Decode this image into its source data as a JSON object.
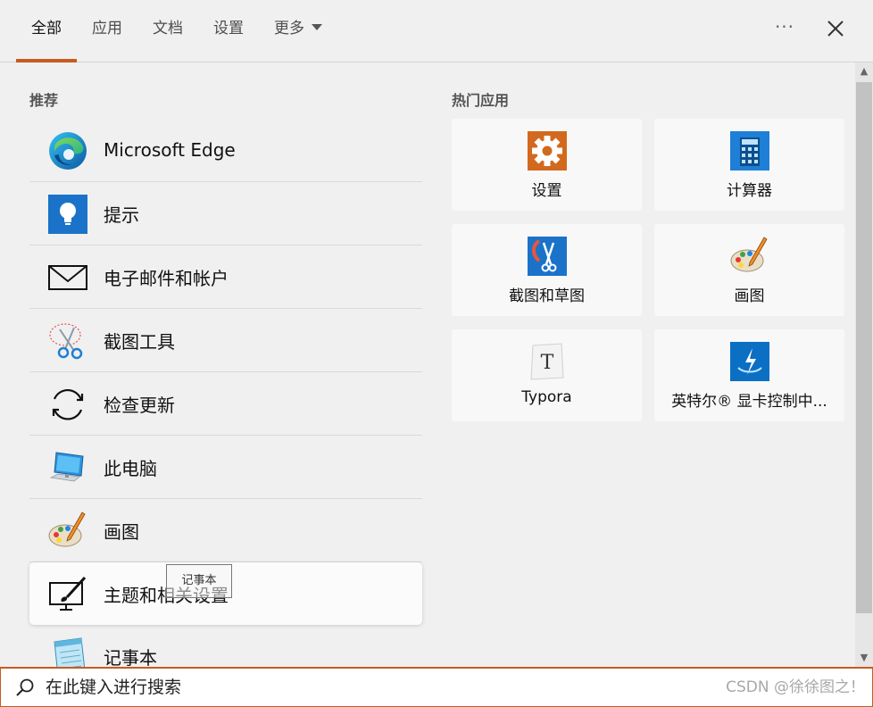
{
  "tabs": [
    {
      "label": "全部",
      "active": true
    },
    {
      "label": "应用",
      "active": false
    },
    {
      "label": "文档",
      "active": false
    },
    {
      "label": "设置",
      "active": false
    },
    {
      "label": "更多",
      "active": false,
      "dropdown": true
    }
  ],
  "header_icons": {
    "more": "more-options-icon",
    "close": "close-icon"
  },
  "recommended": {
    "title": "推荐",
    "items": [
      {
        "label": "Microsoft Edge",
        "icon": "edge-icon"
      },
      {
        "label": "提示",
        "icon": "tips-icon"
      },
      {
        "label": "电子邮件和帐户",
        "icon": "mail-icon"
      },
      {
        "label": "截图工具",
        "icon": "snipping-tool-icon"
      },
      {
        "label": "检查更新",
        "icon": "refresh-icon"
      },
      {
        "label": "此电脑",
        "icon": "computer-icon"
      },
      {
        "label": "画图",
        "icon": "paint-icon"
      },
      {
        "label": "主题和相关设置",
        "icon": "theme-icon"
      },
      {
        "label": "记事本",
        "icon": "notepad-icon"
      }
    ]
  },
  "tooltip": {
    "text": "记事本"
  },
  "hot_apps": {
    "title": "热门应用",
    "items": [
      {
        "label": "设置",
        "icon": "settings-gear-icon"
      },
      {
        "label": "计算器",
        "icon": "calculator-icon"
      },
      {
        "label": "截图和草图",
        "icon": "snip-sketch-icon"
      },
      {
        "label": "画图",
        "icon": "paint-icon"
      },
      {
        "label": "Typora",
        "icon": "typora-icon"
      },
      {
        "label": "英特尔® 显卡控制中...",
        "icon": "intel-graphics-icon"
      }
    ]
  },
  "search": {
    "value": "在此键入进行搜索",
    "icon": "search-icon"
  },
  "watermark": "CSDN @徐徐图之！",
  "colors": {
    "accent": "#c75b1e",
    "background": "#f0f0f0",
    "tile": "#f8f8f8"
  }
}
